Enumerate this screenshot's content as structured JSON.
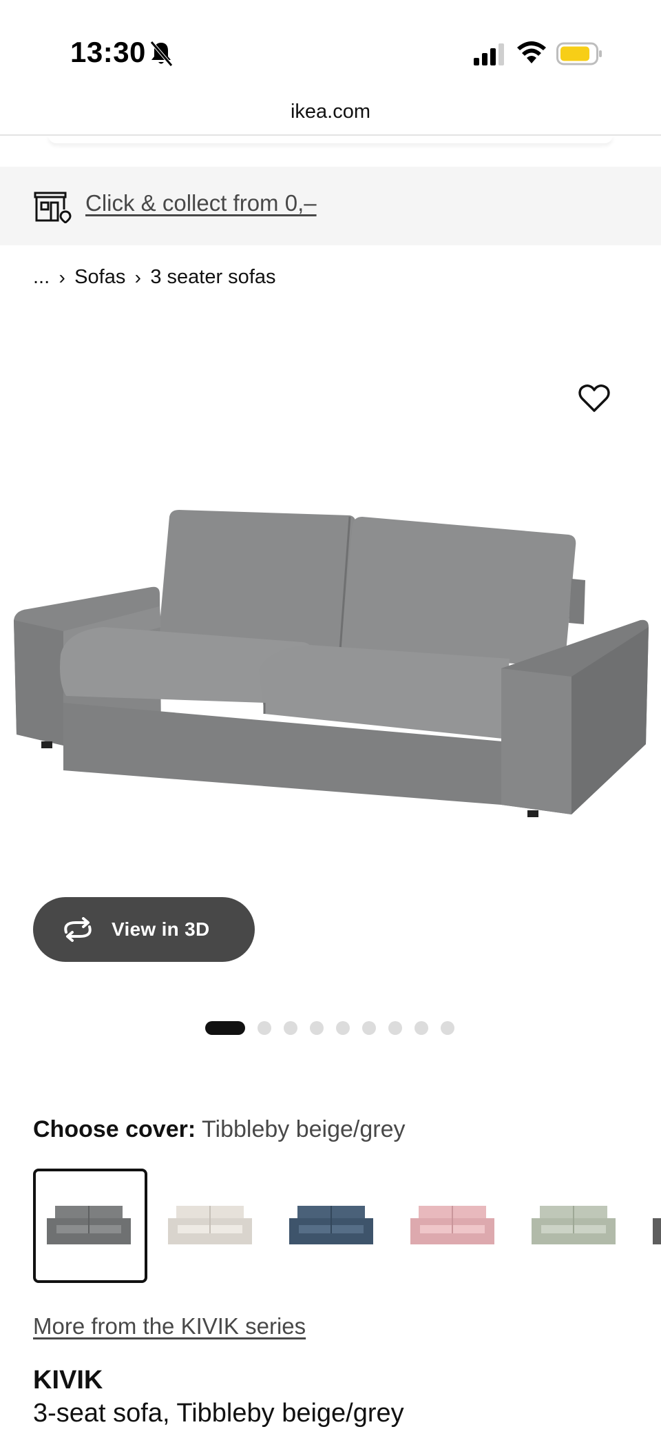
{
  "status_bar": {
    "time": "13:30",
    "icons": [
      "bell-off-icon",
      "signal-icon",
      "wifi-icon",
      "battery-icon"
    ],
    "battery_color": "#F7CE17"
  },
  "browser": {
    "url": "ikea.com"
  },
  "banner": {
    "icon": "store-icon",
    "text": "Click & collect from 0,–"
  },
  "breadcrumb": {
    "items": [
      "...",
      "Sofas",
      "3 seater sofas"
    ],
    "separator": "›"
  },
  "product_gallery": {
    "favorite_icon": "heart-icon",
    "image_subject": "grey 3-seat sofa",
    "view_3d_label": "View in 3D",
    "total_images": 9,
    "active_image": 1
  },
  "cover": {
    "label": "Choose cover:",
    "value": "Tibbleby beige/grey",
    "swatch_colors": [
      "#7D7F80",
      "#E6E1DA",
      "#4A6179",
      "#E8B9BD",
      "#BFC7B8",
      "#6E6E6E"
    ],
    "selected_index": 0
  },
  "series_link": "More from the KIVIK series",
  "product": {
    "name": "KIVIK",
    "description": "3-seat sofa, Tibbleby beige/grey"
  }
}
